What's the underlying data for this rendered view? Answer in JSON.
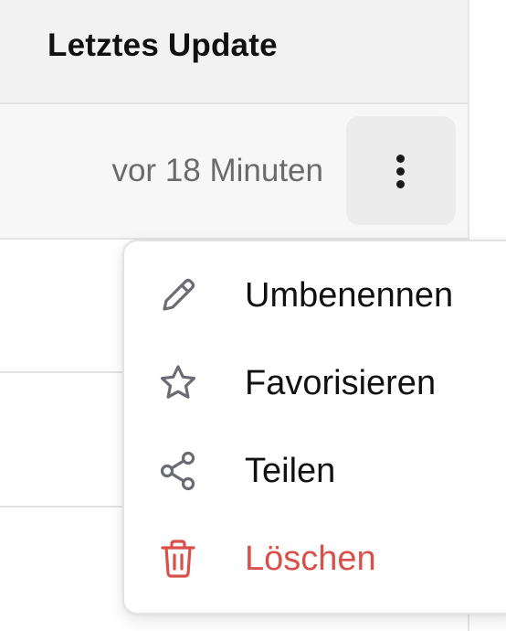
{
  "table": {
    "column_header": "Letztes Update",
    "rows": [
      {
        "last_update": "vor 18 Minuten"
      }
    ]
  },
  "menu": {
    "items": [
      {
        "label": "Umbenennen",
        "icon": "pencil-icon"
      },
      {
        "label": "Favorisieren",
        "icon": "star-icon"
      },
      {
        "label": "Teilen",
        "icon": "share-icon"
      },
      {
        "label": "Löschen",
        "icon": "trash-icon"
      }
    ]
  },
  "colors": {
    "danger": "#d9504a",
    "icon_gray": "#6b6b73",
    "text": "#111111",
    "muted_text": "#6b6b6b"
  }
}
